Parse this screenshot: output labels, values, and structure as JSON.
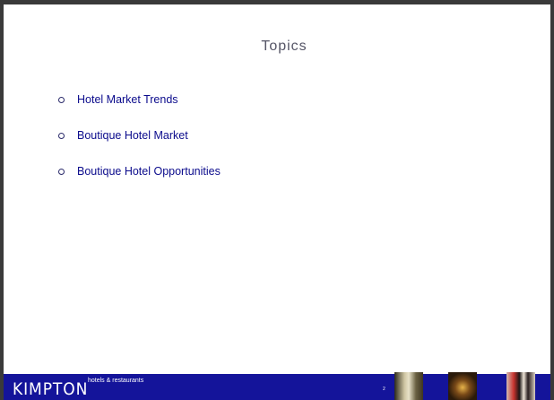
{
  "slide": {
    "title": "Topics",
    "bullets": [
      "Hotel Market Trends",
      "Boutique Hotel Market",
      "Boutique Hotel Opportunities"
    ]
  },
  "footer": {
    "logo_text": "KIMPTON",
    "logo_subtext": "hotels & restaurants",
    "page_number": "2",
    "background_color": "#14149a"
  },
  "colors": {
    "title": "#555566",
    "bullet_text": "#0b0b8c",
    "frame": "#3a3a3a"
  }
}
